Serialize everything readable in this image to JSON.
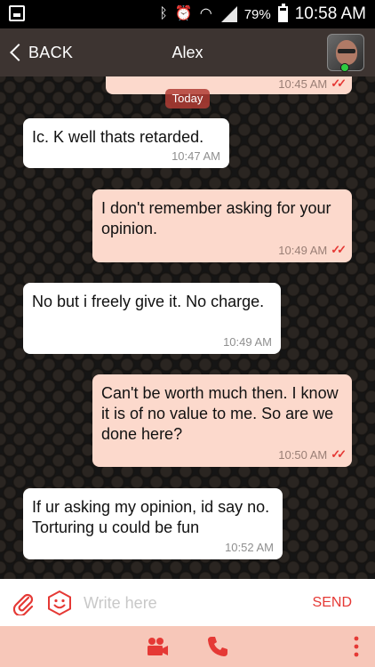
{
  "status_bar": {
    "battery_percent": "79%",
    "time": "10:58 AM"
  },
  "header": {
    "back_label": "BACK",
    "contact_name": "Alex"
  },
  "chat": {
    "date_divider": "Today",
    "messages": [
      {
        "direction": "sent",
        "text": "",
        "time": "10:45 AM",
        "read": true
      },
      {
        "direction": "received",
        "text": "Ic. K well thats retarded.",
        "time": "10:47 AM"
      },
      {
        "direction": "sent",
        "text": "I don't remember asking for your opinion.",
        "time": "10:49 AM",
        "read": true
      },
      {
        "direction": "received",
        "text": "No but i freely give it. No charge.",
        "time": "10:49 AM"
      },
      {
        "direction": "sent",
        "text": "Can't be worth much then. I know it is of no value to me. So are we done here?",
        "time": "10:50 AM",
        "read": true
      },
      {
        "direction": "received",
        "text": "If ur asking my opinion, id say no. Torturing u could be fun",
        "time": "10:52 AM"
      }
    ]
  },
  "composer": {
    "placeholder": "Write here",
    "send_label": "SEND"
  },
  "icons": {
    "attach": "paperclip-icon",
    "emoji": "smiley-hexagon-icon",
    "video": "video-camera-icon",
    "call": "phone-icon",
    "more": "vertical-dots-icon"
  },
  "colors": {
    "accent": "#e53935",
    "sent_bubble": "#fcd9cc",
    "received_bubble": "#ffffff",
    "header": "#3d3431",
    "bottom_bar": "#f7c7b9"
  }
}
